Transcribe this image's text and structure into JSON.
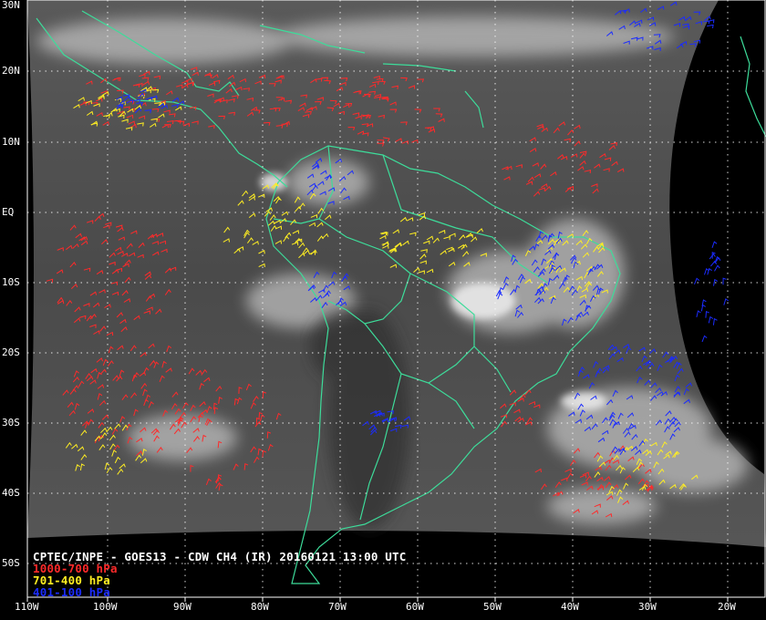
{
  "map": {
    "title": "CPTEC/INPE - GOES13 - CDW CH4 (IR) 20160121 13:00 UTC",
    "legend": [
      {
        "label": "1000-700 hPa",
        "color": "#ff2a2a"
      },
      {
        "label": "701-400 hPa",
        "color": "#ffee22"
      },
      {
        "label": "401-100 hPa",
        "color": "#1b2cff"
      }
    ],
    "lat_labels": [
      "30N",
      "20N",
      "10N",
      "EQ",
      "10S",
      "20S",
      "30S",
      "40S",
      "50S"
    ],
    "lon_labels": [
      "110W",
      "100W",
      "90W",
      "80W",
      "70W",
      "60W",
      "50W",
      "40W",
      "30W",
      "20W"
    ],
    "colors": {
      "coast": "#3ddc9a",
      "grid": "#ffffff",
      "background": "#000000"
    }
  }
}
